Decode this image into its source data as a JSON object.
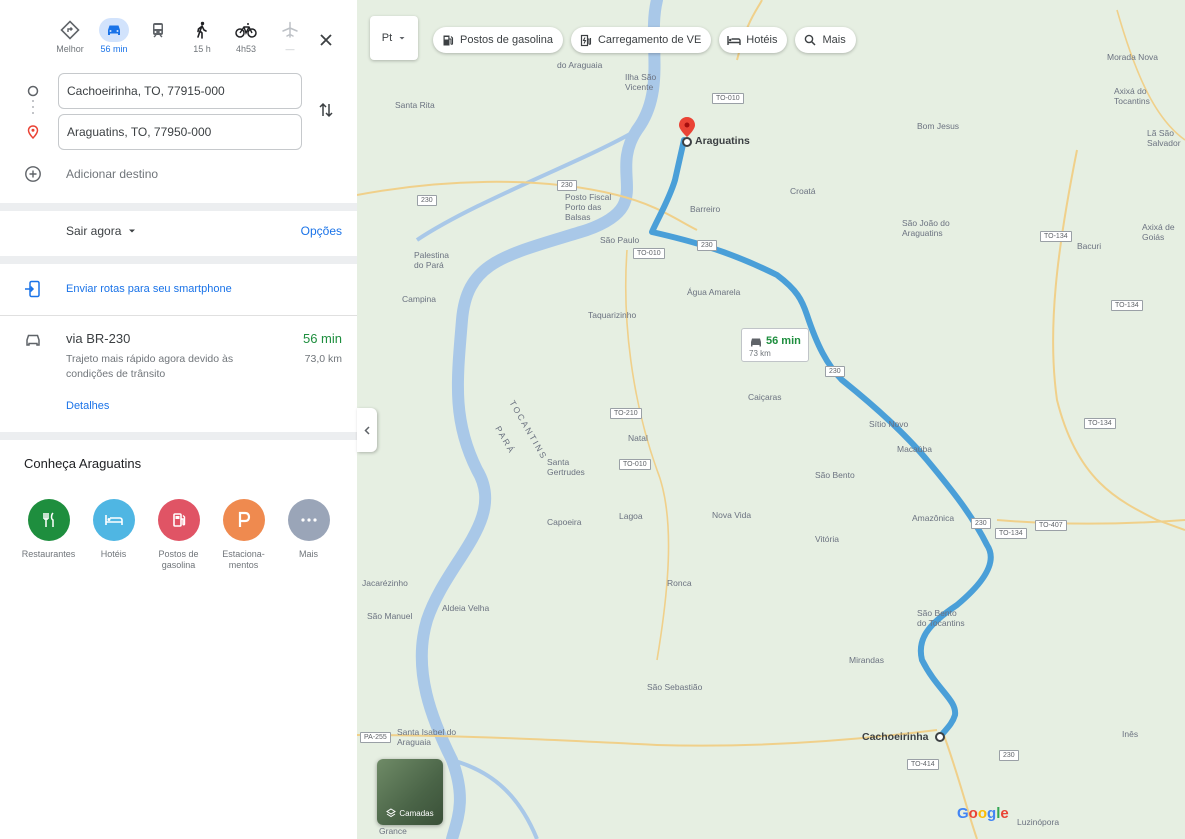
{
  "modes": [
    {
      "name": "best",
      "label": "Melhor"
    },
    {
      "name": "car",
      "label": "56 min",
      "active": true
    },
    {
      "name": "transit",
      "label": ""
    },
    {
      "name": "walk",
      "label": "15 h"
    },
    {
      "name": "bike",
      "label": "4h53"
    },
    {
      "name": "flight",
      "label": "—"
    }
  ],
  "origin": {
    "value": "Cachoeirinha, TO, 77915-000"
  },
  "destination": {
    "value": "Araguatins, TO, 77950-000"
  },
  "add_destination": "Adicionar destino",
  "depart": "Sair agora",
  "options": "Opções",
  "send_to_phone": "Enviar rotas para seu smartphone",
  "route": {
    "name": "via BR-230",
    "time": "56 min",
    "description": "Trajeto mais rápido agora devido às condições de trânsito",
    "distance": "73,0 km",
    "details": "Detalhes"
  },
  "explore": {
    "title": "Conheça Araguatins",
    "categories": [
      {
        "label": "Restaurantes",
        "color": "#1e8e3e"
      },
      {
        "label": "Hotéis",
        "color": "#4fb6e3"
      },
      {
        "label": "Postos de gasolina",
        "color": "#e05465"
      },
      {
        "label": "Estaciona-mentos",
        "color": "#ef8a4f"
      },
      {
        "label": "Mais",
        "color": "#9aa5b8"
      }
    ]
  },
  "map": {
    "type_button": "Pt",
    "chips": [
      "Postos de gasolina",
      "Carregamento de VE",
      "Hotéis",
      "Mais"
    ],
    "layers": "Camadas",
    "bubble_time": "56 min",
    "bubble_distance": "73 km",
    "cities": {
      "destination": "Araguatins",
      "origin": "Cachoeirinha"
    },
    "places": [
      "Morada Nova",
      "Axixá do Tocantins",
      "Lã São Salvador",
      "Ilha São Vicente",
      "do Araguaia",
      "Santa Rita",
      "Bom Jesus",
      "Posto Fiscal Porto das Balsas",
      "Barreiro",
      "Croatá",
      "São João do Araguatins",
      "Axixá de Goiás",
      "Bacuri",
      "Palestina do Pará",
      "São Paulo",
      "Campina",
      "Água Amarela",
      "Taquarizinho",
      "Caiçaras",
      "TOCANTINS",
      "PARÁ",
      "Natal",
      "Sítio Novo",
      "Macaúba",
      "Santa Gertrudes",
      "São Bento",
      "Lagoa",
      "Nova Vida",
      "Capoeira",
      "Amazônica",
      "Vitória",
      "Ronca",
      "Jacarézinho",
      "Aldeia Velha",
      "São Manuel",
      "São Bento do Tocantins",
      "Mirandas",
      "São Sebastião",
      "Santa Isabel do Araguaia",
      "Inês",
      "Grance",
      "Luzinópora"
    ],
    "shields": [
      "TO-010",
      "230",
      "230",
      "230",
      "TO-010",
      "TO-134",
      "TO-134",
      "230",
      "TO-210",
      "TO-010",
      "TO-134",
      "230",
      "TO-134",
      "TO-407",
      "PA-255",
      "230",
      "TO-414"
    ],
    "google": "Google"
  },
  "colors": {
    "route": "#4a9fd8",
    "accent": "#1a73e8",
    "green": "#1e8e3e",
    "pin": "#ea4335"
  }
}
